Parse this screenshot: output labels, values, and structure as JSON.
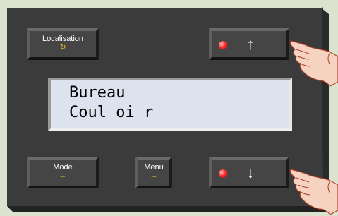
{
  "buttons": {
    "localisation": {
      "label": "Localisation",
      "sub": "↻"
    },
    "mode": {
      "label": "Mode",
      "sub": "←"
    },
    "menu": {
      "label": "Menu",
      "sub": "→"
    },
    "up": {
      "arrow": "↑"
    },
    "down": {
      "arrow": "↓"
    }
  },
  "display": {
    "line1": "Bureau",
    "line2": "Coul oi r"
  },
  "colors": {
    "background": "#dbe3cf",
    "panel": "#3b3b3b",
    "screen": "#dce3ef",
    "led": "#ff3030",
    "accent": "#f0c419"
  },
  "icons": {
    "led": "red-led-icon",
    "hand": "pointing-hand-icon"
  }
}
